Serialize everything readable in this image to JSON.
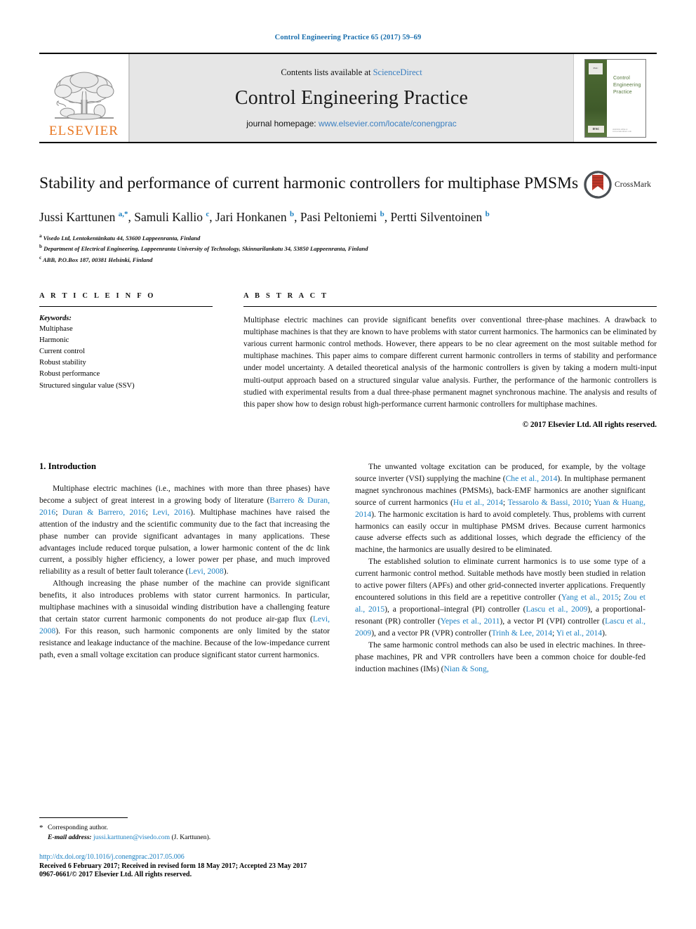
{
  "running_head": "Control Engineering Practice 65 (2017) 59–69",
  "banner": {
    "publisher_name": "ELSEVIER",
    "contents_prefix": "Contents lists available at ",
    "contents_link": "ScienceDirect",
    "journal_name": "Control Engineering Practice",
    "homepage_label": "journal homepage: ",
    "homepage_url": "www.elsevier.com/locate/conengprac",
    "cover_title": "Control\nEngineering\nPractice",
    "cover_badge_top": "IFAC",
    "cover_badge_bottom": "IFAC",
    "cover_footer": "Available online at www.sciencedirect.com"
  },
  "article": {
    "title": "Stability and performance of current harmonic controllers for multiphase PMSMs",
    "crossmark_label": "CrossMark",
    "authors": [
      {
        "name": "Jussi Karttunen",
        "marks": "a,*"
      },
      {
        "name": "Samuli Kallio",
        "marks": "c"
      },
      {
        "name": "Jari Honkanen",
        "marks": "b"
      },
      {
        "name": "Pasi Peltoniemi",
        "marks": "b"
      },
      {
        "name": "Pertti Silventoinen",
        "marks": "b"
      }
    ],
    "affiliations": [
      {
        "mark": "a",
        "text": "Visedo Ltd, Lentokentänkatu 44, 53600 Lappeenranta, Finland"
      },
      {
        "mark": "b",
        "text": "Department of Electrical Engineering, Lappeenranta University of Technology, Skinnarilankatu 34, 53850 Lappeenranta, Finland"
      },
      {
        "mark": "c",
        "text": "ABB, P.O.Box 187, 00381 Helsinki, Finland"
      }
    ]
  },
  "article_info": {
    "heading": "A R T I C L E    I N F O",
    "keywords_title": "Keywords:",
    "keywords": [
      "Multiphase",
      "Harmonic",
      "Current control",
      "Robust stability",
      "Robust performance",
      "Structured singular value (SSV)"
    ]
  },
  "abstract": {
    "heading": "A B S T R A C T",
    "text": "Multiphase electric machines can provide significant benefits over conventional three-phase machines. A drawback to multiphase machines is that they are known to have problems with stator current harmonics. The harmonics can be eliminated by various current harmonic control methods. However, there appears to be no clear agreement on the most suitable method for multiphase machines. This paper aims to compare different current harmonic controllers in terms of stability and performance under model uncertainty. A detailed theoretical analysis of the harmonic controllers is given by taking a modern multi-input multi-output approach based on a structured singular value analysis. Further, the performance of the harmonic controllers is studied with experimental results from a dual three-phase permanent magnet synchronous machine. The analysis and results of this paper show how to design robust high-performance current harmonic controllers for multiphase machines.",
    "copyright": "© 2017 Elsevier Ltd. All rights reserved."
  },
  "body": {
    "section_title": "1. Introduction",
    "left_paragraphs": [
      "Multiphase electric machines (i.e., machines with more than three phases) have become a subject of great interest in a growing body of literature (Barrero & Duran, 2016; Duran & Barrero, 2016; Levi, 2016). Multiphase machines have raised the attention of the industry and the scientific community due to the fact that increasing the phase number can provide significant advantages in many applications. These advantages include reduced torque pulsation, a lower harmonic content of the dc link current, a possibly higher efficiency, a lower power per phase, and much improved reliability as a result of better fault tolerance (Levi, 2008).",
      "Although increasing the phase number of the machine can provide significant benefits, it also introduces problems with stator current harmonics. In particular, multiphase machines with a sinusoidal winding distribution have a challenging feature that certain stator current harmonic components do not produce air-gap flux (Levi, 2008). For this reason, such harmonic components are only limited by the stator resistance and leakage inductance of the machine. Because of the low-impedance current path, even a small voltage excitation can produce significant stator current harmonics."
    ],
    "right_paragraphs": [
      "The unwanted voltage excitation can be produced, for example, by the voltage source inverter (VSI) supplying the machine (Che et al., 2014). In multiphase permanent magnet synchronous machines (PMSMs), back-EMF harmonics are another significant source of current harmonics (Hu et al., 2014; Tessarolo & Bassi, 2010; Yuan & Huang, 2014). The harmonic excitation is hard to avoid completely. Thus, problems with current harmonics can easily occur in multiphase PMSM drives. Because current harmonics cause adverse effects such as additional losses, which degrade the efficiency of the machine, the harmonics are usually desired to be eliminated.",
      "The established solution to eliminate current harmonics is to use some type of a current harmonic control method. Suitable methods have mostly been studied in relation to active power filters (APFs) and other grid-connected inverter applications. Frequently encountered solutions in this field are a repetitive controller (Yang et al., 2015; Zou et al., 2015), a proportional–integral (PI) controller (Lascu et al., 2009), a proportional-resonant (PR) controller (Yepes et al., 2011), a vector PI (VPI) controller (Lascu et al., 2009), and a vector PR (VPR) controller (Trinh & Lee, 2014; Yi et al., 2014).",
      "The same harmonic control methods can also be used in electric machines. In three-phase machines, PR and VPR controllers have been a common choice for double-fed induction machines (IMs) (Nian & Song,"
    ]
  },
  "footer": {
    "corresponding_marker": "*",
    "corresponding_text": "Corresponding author.",
    "email_label": "E-mail address:",
    "email_address": "jussi.karttunen@visedo.com",
    "email_suffix": "(J. Karttunen).",
    "doi": "http://dx.doi.org/10.1016/j.conengprac.2017.05.006",
    "history": "Received 6 February 2017; Received in revised form 18 May 2017; Accepted 23 May 2017",
    "issn_line": "0967-0661/© 2017 Elsevier Ltd. All rights reserved."
  },
  "colors": {
    "link_blue": "#1a7fc1",
    "elsevier_orange": "#e87722",
    "banner_grey": "#e6e6e6",
    "cover_green": "#4e6b34"
  }
}
